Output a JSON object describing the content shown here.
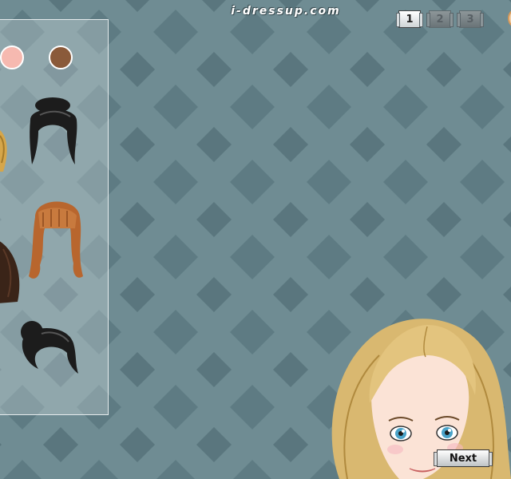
{
  "site": {
    "logo": "i-dressup.com"
  },
  "steps": [
    {
      "label": "1",
      "active": true
    },
    {
      "label": "2",
      "active": false
    },
    {
      "label": "3",
      "active": false
    }
  ],
  "colors": {
    "background": "#6f8c93",
    "diamond": "#5e7b83",
    "panel_border": "#e6ecee"
  },
  "skin_swatches": [
    {
      "color": "#f6b9b0",
      "icon": "skin-tone-light"
    },
    {
      "color": "#8a5a3a",
      "icon": "skin-tone-dark"
    }
  ],
  "hairstyles": [
    {
      "icon": "black-updo-hair",
      "color": "#1c1c1c"
    },
    {
      "icon": "auburn-wavy-bangs-hair",
      "color": "#b8662e"
    },
    {
      "icon": "black-ponytail-hair",
      "color": "#1c1c1c"
    }
  ],
  "buttons": {
    "next": "Next"
  }
}
